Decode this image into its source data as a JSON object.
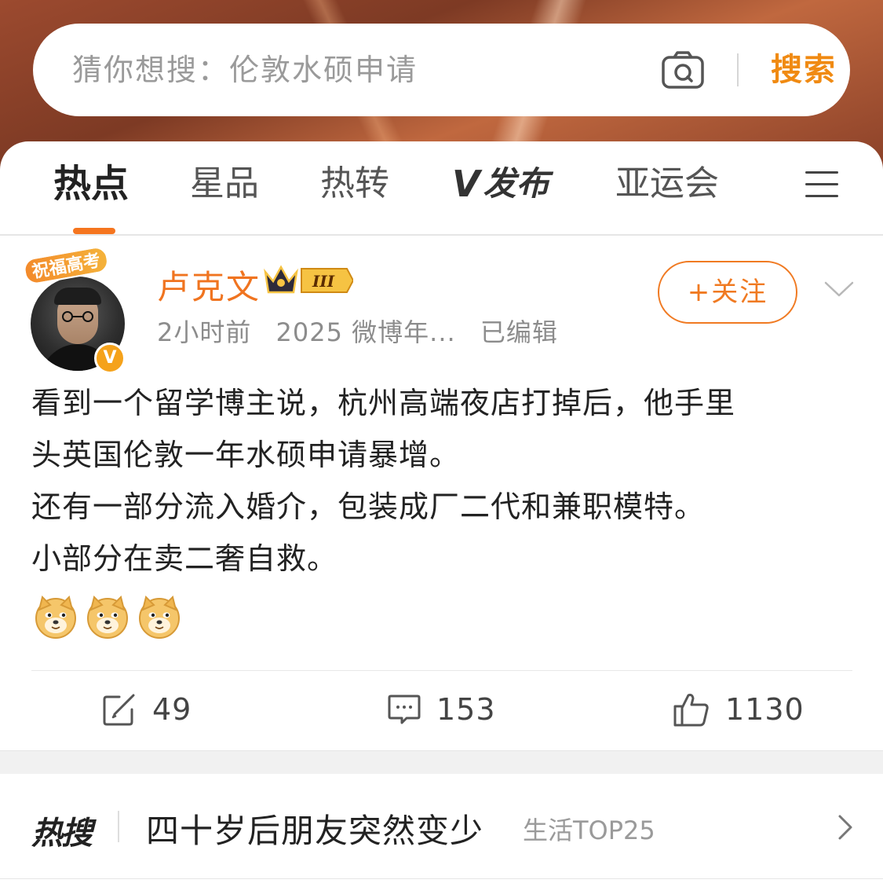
{
  "search": {
    "placeholder": "猜你想搜：伦敦水硕申请",
    "button_label": "搜索"
  },
  "tabs": [
    {
      "label": "热点",
      "active": true
    },
    {
      "label": "星品",
      "active": false
    },
    {
      "label": "热转",
      "active": false
    },
    {
      "label": "发布",
      "logo": "V",
      "active": false
    },
    {
      "label": "亚运会",
      "active": false
    }
  ],
  "post": {
    "avatar_badge": "祝福高考",
    "username": "卢克文",
    "vip_level": "III",
    "verified_mark": "V",
    "meta": {
      "time": "2小时前",
      "source": "2025 微博年...",
      "edited": "已编辑"
    },
    "follow_label": "+关注",
    "text_lines": [
      "看到一个留学博主说，杭州高端夜店打掉后，他手里",
      "头英国伦敦一年水硕申请暴增。",
      "还有一部分流入婚介，包装成厂二代和兼职模特。",
      "小部分在卖二奢自救。"
    ],
    "emojis": [
      "doge-icon",
      "doge-icon",
      "doge-icon"
    ],
    "actions": {
      "repost_count": "49",
      "comment_count": "153",
      "like_count": "1130"
    }
  },
  "hot_search": {
    "logo": "热搜",
    "title": "四十岁后朋友突然变少",
    "tag": "生活TOP25"
  },
  "colors": {
    "accent": "#f07a22",
    "username": "#f07420",
    "tab_indicator": "#f5751f"
  }
}
